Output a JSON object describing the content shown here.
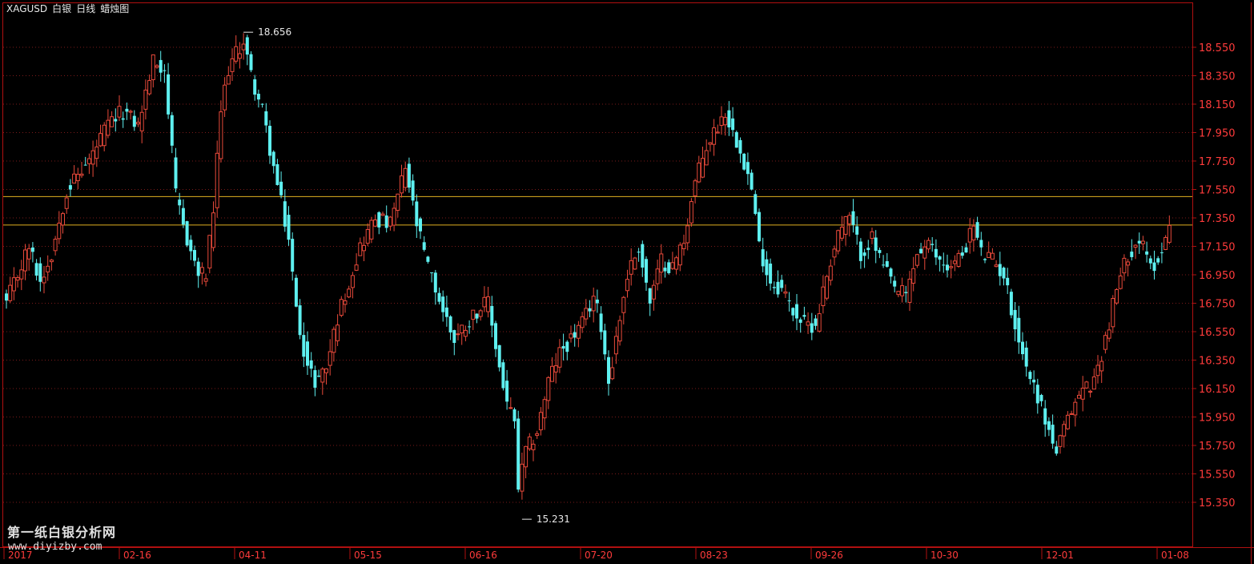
{
  "header": {
    "symbol": "XAGUSD",
    "name": "白银",
    "period": "日线",
    "chart_kind": "蜡烛图"
  },
  "watermark": {
    "brand": "第一纸白银分析网",
    "url": "www.diyizby.com"
  },
  "colors": {
    "background": "#000000",
    "frame": "#b01010",
    "grid": "#7a1a1a",
    "up_candle": "#e8493a",
    "down_candle": "#5ef0f0",
    "price_label": "#ff3b3b",
    "hline": "#e0b020",
    "text": "#e8e8e8"
  },
  "chart_data": {
    "type": "candlestick",
    "yticks": [
      "18.550",
      "18.350",
      "18.150",
      "17.950",
      "17.750",
      "17.550",
      "17.350",
      "17.150",
      "16.950",
      "16.750",
      "16.550",
      "16.350",
      "16.150",
      "15.950",
      "15.750",
      "15.550",
      "15.350"
    ],
    "ylim": [
      15.23,
      18.75
    ],
    "date_labels": [
      "2017",
      "02-16",
      "04-11",
      "05-15",
      "06-16",
      "07-20",
      "08-23",
      "09-26",
      "10-30",
      "12-01",
      "01-08"
    ],
    "horizontal_lines": [
      17.5,
      17.3
    ],
    "annotations": {
      "high": {
        "value": "18.656",
        "price": 18.656
      },
      "low": {
        "value": "15.231",
        "price": 15.231
      }
    },
    "anchors": [
      {
        "i": 0,
        "p": 16.75
      },
      {
        "i": 6,
        "p": 17.15
      },
      {
        "i": 9,
        "p": 16.9
      },
      {
        "i": 12,
        "p": 17.1
      },
      {
        "i": 16,
        "p": 17.55
      },
      {
        "i": 22,
        "p": 17.75
      },
      {
        "i": 27,
        "p": 18.0
      },
      {
        "i": 31,
        "p": 18.1
      },
      {
        "i": 35,
        "p": 18.0
      },
      {
        "i": 39,
        "p": 18.45
      },
      {
        "i": 42,
        "p": 18.4
      },
      {
        "i": 45,
        "p": 17.5
      },
      {
        "i": 48,
        "p": 17.2
      },
      {
        "i": 51,
        "p": 16.95
      },
      {
        "i": 53,
        "p": 16.95
      },
      {
        "i": 55,
        "p": 17.4
      },
      {
        "i": 57,
        "p": 18.1
      },
      {
        "i": 59,
        "p": 18.4
      },
      {
        "i": 63,
        "p": 18.6
      },
      {
        "i": 65,
        "p": 18.35
      },
      {
        "i": 68,
        "p": 18.1
      },
      {
        "i": 71,
        "p": 17.7
      },
      {
        "i": 75,
        "p": 17.2
      },
      {
        "i": 77,
        "p": 16.7
      },
      {
        "i": 80,
        "p": 16.3
      },
      {
        "i": 82,
        "p": 16.2
      },
      {
        "i": 85,
        "p": 16.3
      },
      {
        "i": 88,
        "p": 16.65
      },
      {
        "i": 91,
        "p": 16.9
      },
      {
        "i": 94,
        "p": 17.15
      },
      {
        "i": 98,
        "p": 17.35
      },
      {
        "i": 102,
        "p": 17.3
      },
      {
        "i": 106,
        "p": 17.7
      },
      {
        "i": 109,
        "p": 17.3
      },
      {
        "i": 112,
        "p": 17.0
      },
      {
        "i": 116,
        "p": 16.7
      },
      {
        "i": 119,
        "p": 16.5
      },
      {
        "i": 122,
        "p": 16.6
      },
      {
        "i": 125,
        "p": 16.7
      },
      {
        "i": 128,
        "p": 16.75
      },
      {
        "i": 131,
        "p": 16.3
      },
      {
        "i": 133,
        "p": 16.05
      },
      {
        "i": 135,
        "p": 15.9
      },
      {
        "i": 136,
        "p": 15.45
      },
      {
        "i": 138,
        "p": 15.7
      },
      {
        "i": 141,
        "p": 15.85
      },
      {
        "i": 144,
        "p": 16.2
      },
      {
        "i": 147,
        "p": 16.4
      },
      {
        "i": 150,
        "p": 16.5
      },
      {
        "i": 153,
        "p": 16.6
      },
      {
        "i": 156,
        "p": 16.8
      },
      {
        "i": 158,
        "p": 16.6
      },
      {
        "i": 160,
        "p": 16.2
      },
      {
        "i": 162,
        "p": 16.5
      },
      {
        "i": 165,
        "p": 16.95
      },
      {
        "i": 168,
        "p": 17.15
      },
      {
        "i": 171,
        "p": 16.75
      },
      {
        "i": 174,
        "p": 17.05
      },
      {
        "i": 177,
        "p": 17.0
      },
      {
        "i": 180,
        "p": 17.2
      },
      {
        "i": 183,
        "p": 17.6
      },
      {
        "i": 186,
        "p": 17.85
      },
      {
        "i": 189,
        "p": 18.0
      },
      {
        "i": 191,
        "p": 18.1
      },
      {
        "i": 193,
        "p": 17.95
      },
      {
        "i": 195,
        "p": 17.85
      },
      {
        "i": 198,
        "p": 17.55
      },
      {
        "i": 200,
        "p": 17.15
      },
      {
        "i": 203,
        "p": 16.9
      },
      {
        "i": 206,
        "p": 16.85
      },
      {
        "i": 209,
        "p": 16.7
      },
      {
        "i": 212,
        "p": 16.6
      },
      {
        "i": 215,
        "p": 16.6
      },
      {
        "i": 218,
        "p": 16.95
      },
      {
        "i": 221,
        "p": 17.25
      },
      {
        "i": 224,
        "p": 17.35
      },
      {
        "i": 227,
        "p": 17.1
      },
      {
        "i": 230,
        "p": 17.2
      },
      {
        "i": 233,
        "p": 17.0
      },
      {
        "i": 236,
        "p": 16.85
      },
      {
        "i": 239,
        "p": 16.8
      },
      {
        "i": 242,
        "p": 17.1
      },
      {
        "i": 245,
        "p": 17.15
      },
      {
        "i": 248,
        "p": 17.05
      },
      {
        "i": 251,
        "p": 17.0
      },
      {
        "i": 254,
        "p": 17.1
      },
      {
        "i": 257,
        "p": 17.3
      },
      {
        "i": 259,
        "p": 17.1
      },
      {
        "i": 262,
        "p": 17.05
      },
      {
        "i": 265,
        "p": 16.95
      },
      {
        "i": 268,
        "p": 16.6
      },
      {
        "i": 271,
        "p": 16.3
      },
      {
        "i": 274,
        "p": 16.1
      },
      {
        "i": 277,
        "p": 15.85
      },
      {
        "i": 279,
        "p": 15.7
      },
      {
        "i": 281,
        "p": 15.85
      },
      {
        "i": 283,
        "p": 16.0
      },
      {
        "i": 286,
        "p": 16.15
      },
      {
        "i": 289,
        "p": 16.2
      },
      {
        "i": 292,
        "p": 16.5
      },
      {
        "i": 295,
        "p": 16.85
      },
      {
        "i": 298,
        "p": 17.1
      },
      {
        "i": 301,
        "p": 17.2
      },
      {
        "i": 304,
        "p": 17.0
      },
      {
        "i": 307,
        "p": 17.1
      },
      {
        "i": 309,
        "p": 17.35
      }
    ]
  }
}
